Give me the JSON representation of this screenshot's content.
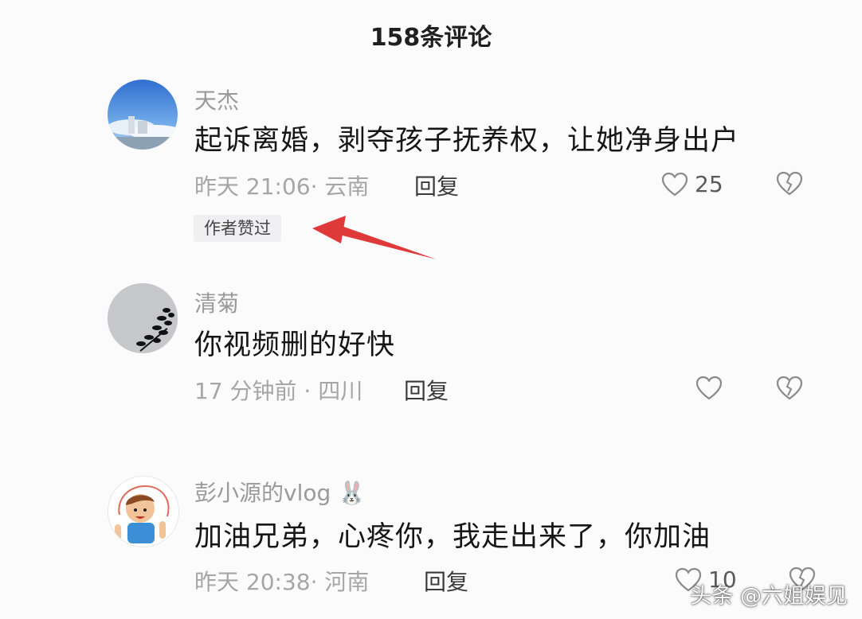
{
  "header": {
    "title": "158条评论"
  },
  "comments": [
    {
      "username": "天杰",
      "text": "起诉离婚，剥夺孩子抚养权，让她净身出户",
      "meta": "昨天 21:06· 云南",
      "reply_label": "回复",
      "like_count": "25",
      "badge": "作者赞过",
      "avatar_icon": "sky-building-avatar"
    },
    {
      "username": "清菊",
      "text": "你视频删的好快",
      "meta": "17 分钟前 · 四川",
      "reply_label": "回复",
      "like_count": "",
      "avatar_icon": "gray-plant-avatar"
    },
    {
      "username": "彭小源的vlog",
      "username_emoji": "🐰",
      "text": "加油兄弟，心疼你，我走出来了，你加油",
      "meta": "昨天 20:38· 河南",
      "reply_label": "回复",
      "like_count": "10",
      "avatar_icon": "cartoon-boy-avatar"
    }
  ],
  "watermark": {
    "text": "头条 @六姐娱见"
  },
  "colors": {
    "background": "#fbfbfc",
    "arrow": "#e0393a",
    "meta_text": "#a6a6a6",
    "username_text": "#9a9a9a"
  }
}
